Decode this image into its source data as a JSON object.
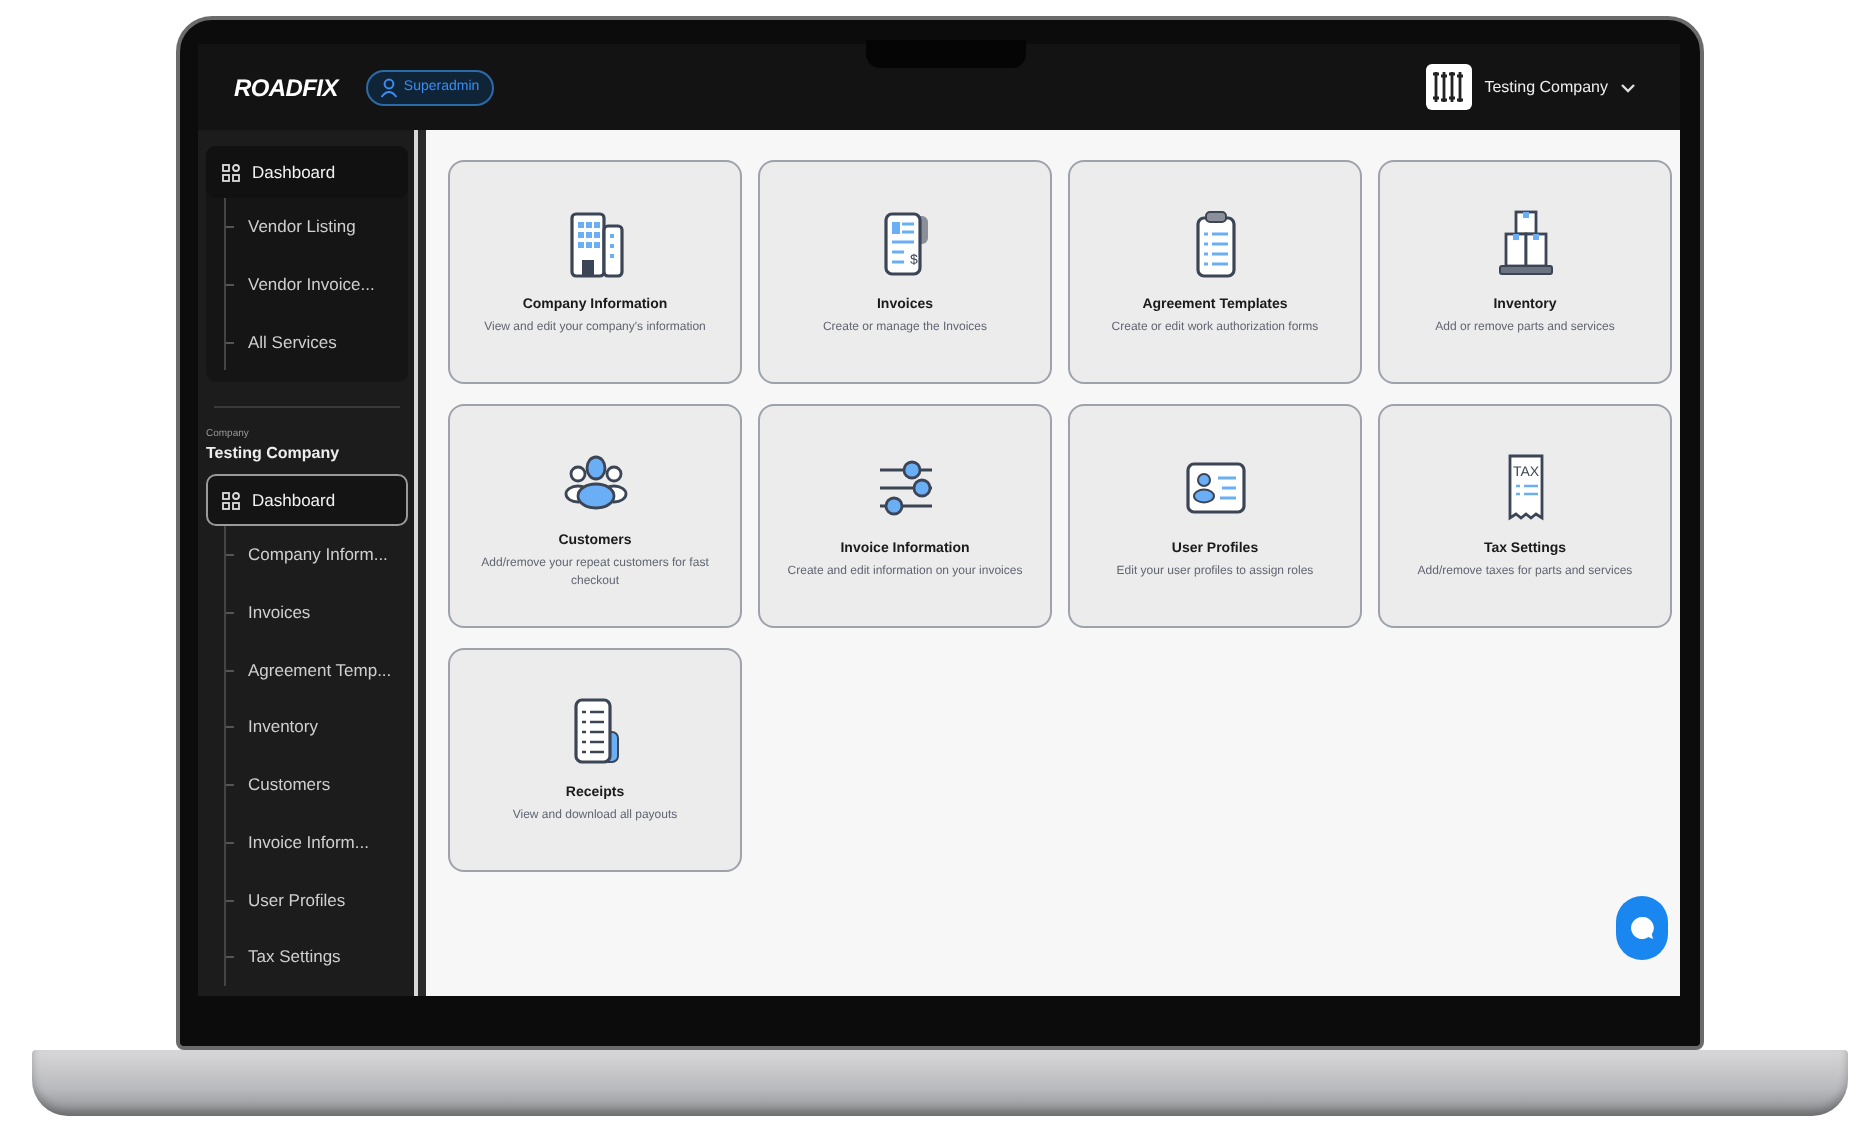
{
  "header": {
    "logo": "ROADFIX",
    "role_badge": "Superadmin",
    "company": "Testing Company"
  },
  "sidebar": {
    "top_group": {
      "label": "Dashboard",
      "selected": false,
      "children": [
        {
          "label": "Vendor Listing"
        },
        {
          "label": "Vendor Invoice..."
        },
        {
          "label": "All Services"
        }
      ]
    },
    "company_caption": "Company",
    "company_name": "Testing Company",
    "company_group": {
      "label": "Dashboard",
      "selected": true,
      "children": [
        {
          "label": "Company Inform..."
        },
        {
          "label": "Invoices"
        },
        {
          "label": "Agreement Temp..."
        },
        {
          "label": "Inventory"
        },
        {
          "label": "Customers"
        },
        {
          "label": "Invoice Inform..."
        },
        {
          "label": "User Profiles"
        },
        {
          "label": "Tax Settings"
        }
      ]
    }
  },
  "cards": [
    {
      "title": "Company Information",
      "description": "View and edit your company's information"
    },
    {
      "title": "Invoices",
      "description": "Create or manage the Invoices",
      "icon_text": "$"
    },
    {
      "title": "Agreement Templates",
      "description": "Create or edit work authorization forms"
    },
    {
      "title": "Inventory",
      "description": "Add or remove parts and services"
    },
    {
      "title": "Customers",
      "description": "Add/remove your repeat customers for fast checkout"
    },
    {
      "title": "Invoice Information",
      "description": "Create and edit information on your invoices"
    },
    {
      "title": "User Profiles",
      "description": "Edit your user profiles to assign roles"
    },
    {
      "title": "Tax Settings",
      "description": "Add/remove taxes for parts and services",
      "icon_text": "TAX"
    },
    {
      "title": "Receipts",
      "description": "View and download all payouts"
    }
  ]
}
